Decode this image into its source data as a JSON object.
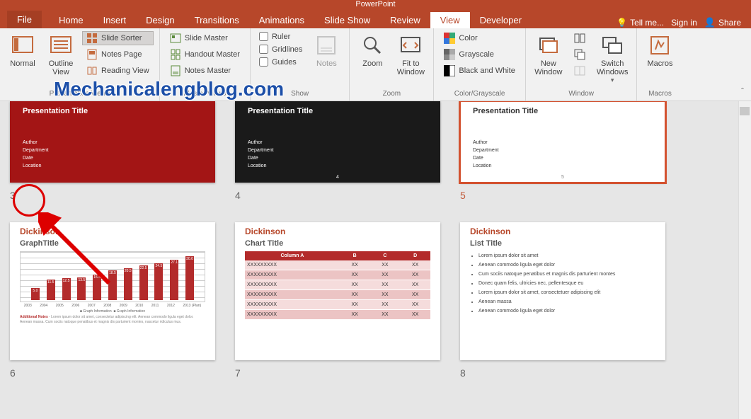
{
  "title_suffix": "PowerPoint",
  "tabs": {
    "file": "File",
    "home": "Home",
    "insert": "Insert",
    "design": "Design",
    "transitions": "Transitions",
    "animations": "Animations",
    "slideshow": "Slide Show",
    "review": "Review",
    "view": "View",
    "developer": "Developer",
    "tellme": "Tell me...",
    "signin": "Sign in",
    "share": "Share"
  },
  "ribbon": {
    "presentation_views": {
      "normal": "Normal",
      "outline": "Outline\nView",
      "sorter": "Slide Sorter",
      "notes_page": "Notes Page",
      "reading": "Reading View",
      "label": "Presentation Views"
    },
    "master_views": {
      "slide": "Slide Master",
      "handout": "Handout Master",
      "notes": "Notes Master",
      "label": "Master Views"
    },
    "show": {
      "ruler": "Ruler",
      "gridlines": "Gridlines",
      "guides": "Guides",
      "notes": "Notes",
      "label": "Show"
    },
    "zoom": {
      "zoom": "Zoom",
      "fit": "Fit to\nWindow",
      "label": "Zoom"
    },
    "color": {
      "color": "Color",
      "gray": "Grayscale",
      "bw": "Black and White",
      "label": "Color/Grayscale"
    },
    "window": {
      "new": "New\nWindow",
      "arrange": "Arrange All",
      "cascade": "Cascade",
      "split": "Move Split",
      "switch": "Switch\nWindows",
      "label": "Window"
    },
    "macros": {
      "macros": "Macros",
      "label": "Macros"
    }
  },
  "watermark": "Mechanicalengblog.com",
  "slides": {
    "s3": {
      "num": "3",
      "title": "Presentation Title",
      "meta": [
        "Author",
        "Department",
        "Date",
        "Location"
      ]
    },
    "s4": {
      "num": "4",
      "title": "Presentation Title",
      "meta": [
        "Author",
        "Department",
        "Date",
        "Location"
      ],
      "page": "4"
    },
    "s5": {
      "num": "5",
      "title": "Presentation Title",
      "meta": [
        "Author",
        "Department",
        "Date",
        "Location"
      ],
      "page": "5"
    },
    "s6": {
      "num": "6",
      "brand": "Dickinson",
      "title": "GraphTitle",
      "footnote_label": "Additional Notes",
      "footnote_text": " - Lorem ipsum dolor sit amet, consectetur adipiscing elit. Aenean commodo ligula eget dolor. Aenean massa. Cum sociis natoque penatibus et magnis dis parturient montes, nascetur ridiculus mus.",
      "legend": [
        "Graph Information",
        "Graph Information"
      ]
    },
    "s7": {
      "num": "7",
      "brand": "Dickinson",
      "title": "Chart Title",
      "headers": [
        "Column A",
        "B",
        "C",
        "D"
      ],
      "rows": [
        [
          "XXXXXXXXX",
          "XX",
          "XX",
          "XX"
        ],
        [
          "XXXXXXXXX",
          "XX",
          "XX",
          "XX"
        ],
        [
          "XXXXXXXXX",
          "XX",
          "XX",
          "XX"
        ],
        [
          "XXXXXXXXX",
          "XX",
          "XX",
          "XX"
        ],
        [
          "XXXXXXXXX",
          "XX",
          "XX",
          "XX"
        ],
        [
          "XXXXXXXXX",
          "XX",
          "XX",
          "XX"
        ]
      ]
    },
    "s8": {
      "num": "8",
      "brand": "Dickinson",
      "title": "List Title",
      "bullets": [
        "Lorem ipsum dolor sit amet",
        "Aenean commodo ligula eget dolor",
        "Cum sociis natoque penatibus et magnis dis parturient montes",
        "Donec quam felis, ultricies nec, pellentesque eu",
        "Lorem ipsum dolor sit amet, consectetuer adipiscing elit",
        "Aenean massa",
        "Aenean commodo ligula eget dolor"
      ]
    }
  },
  "chart_data": {
    "type": "bar",
    "title": "GraphTitle",
    "categories": [
      "2003",
      "2004",
      "2005",
      "2006",
      "2007",
      "2008",
      "2009",
      "2010",
      "2011",
      "2012",
      "2013 (Plan)"
    ],
    "values": [
      5.0,
      11.5,
      12.5,
      13.5,
      15.4,
      18.5,
      20.5,
      22.5,
      24.5,
      27.1,
      30.0
    ],
    "ylim": [
      0,
      32
    ],
    "legend": [
      "Graph Information",
      "Graph Information"
    ]
  }
}
